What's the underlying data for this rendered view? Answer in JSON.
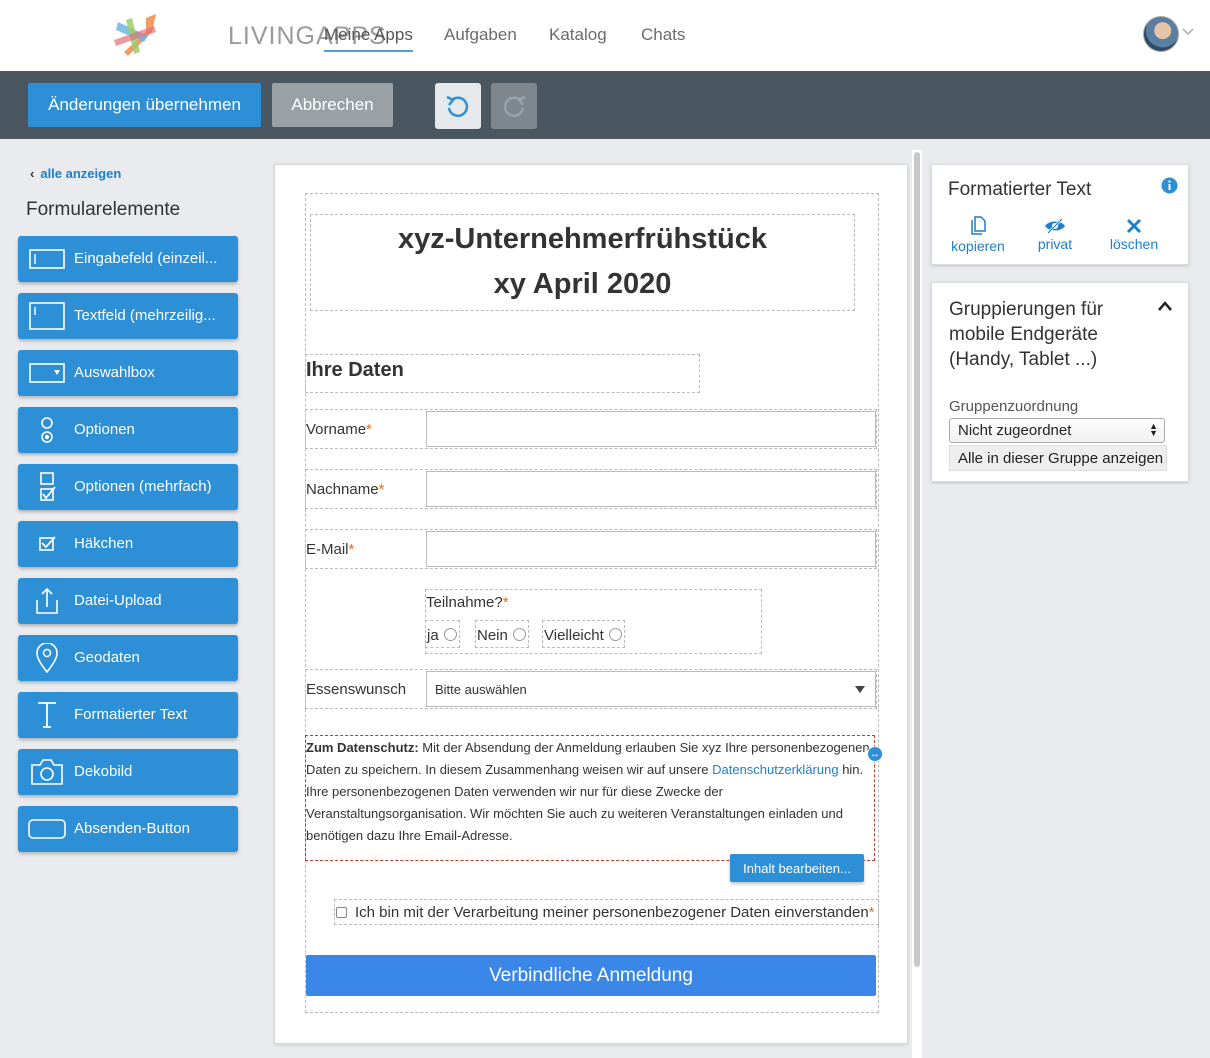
{
  "header": {
    "logo_text": "LIVINGAPPS",
    "nav": [
      "Meine Apps",
      "Aufgaben",
      "Katalog",
      "Chats"
    ],
    "active_tab": "Meine Apps"
  },
  "toolbar": {
    "apply_label": "Änderungen übernehmen",
    "cancel_label": "Abbrechen"
  },
  "sidebar": {
    "back_link": "alle anzeigen",
    "title": "Formularelemente",
    "items": [
      {
        "label": "Eingabefeld (einzeil...",
        "icon": "single-line-input-icon"
      },
      {
        "label": "Textfeld (mehrzeilig...",
        "icon": "multi-line-textarea-icon"
      },
      {
        "label": "Auswahlbox",
        "icon": "select-box-icon"
      },
      {
        "label": "Optionen",
        "icon": "radio-options-icon"
      },
      {
        "label": "Optionen (mehrfach)",
        "icon": "checkbox-options-icon"
      },
      {
        "label": "Häkchen",
        "icon": "checkmark-icon"
      },
      {
        "label": "Datei-Upload",
        "icon": "upload-icon"
      },
      {
        "label": "Geodaten",
        "icon": "map-pin-icon"
      },
      {
        "label": "Formatierter Text",
        "icon": "text-format-icon"
      },
      {
        "label": "Dekobild",
        "icon": "camera-icon"
      },
      {
        "label": "Absenden-Button",
        "icon": "submit-button-icon"
      }
    ]
  },
  "form": {
    "title_line1": "xyz-Unternehmerfrühstück",
    "title_line2": "xy April 2020",
    "section_title": "Ihre Daten",
    "fields": [
      {
        "label": "Vorname",
        "required": "*"
      },
      {
        "label": "Nachname",
        "required": "*"
      },
      {
        "label": "E-Mail",
        "required": "*"
      }
    ],
    "radio_question": "Teilnahme?",
    "radio_required": "*",
    "radio_options": [
      "ja",
      "Nein",
      "Vielleicht"
    ],
    "select_label": "Essenswunsch",
    "select_value": "Bitte auswählen",
    "privacy_bold": "Zum Datenschutz:",
    "privacy_part1": " Mit der Absendung der Anmeldung erlauben Sie xyz Ihre personenbezogenen Daten zu speichern. In diesem Zusammenhang weisen wir auf  unsere ",
    "privacy_link": "Datenschutzerklärung",
    "privacy_part2": " hin. Ihre personenbezogenen Daten verwenden wir nur für diese Zwecke der Veranstaltungsorganisation. Wir möchten Sie auch zu weiteren Veranstaltungen einladen und benötigen dazu Ihre Email-Adresse.",
    "edit_button": "Inhalt bearbeiten...",
    "consent_text": "Ich bin mit der Verarbeitung meiner personenbezogener Daten einverstanden",
    "consent_required": "*",
    "submit_label": "Verbindliche Anmeldung"
  },
  "properties_panel": {
    "title": "Formatierter Text",
    "actions": [
      {
        "label": "kopieren",
        "icon": "copy-icon"
      },
      {
        "label": "privat",
        "icon": "eye-slash-icon"
      },
      {
        "label": "löschen",
        "icon": "delete-x-icon"
      }
    ]
  },
  "grouping_panel": {
    "title": "Gruppierungen für mobile Endgeräte (Handy, Tablet ...)",
    "group_label": "Gruppenzuordnung",
    "group_value": "Nicht zugeordnet",
    "show_group_button": "Alle in dieser Gruppe anzeigen"
  },
  "colors": {
    "primary": "#2d8fd5",
    "toolbar_bg": "#4a5660",
    "submit": "#3b87e8",
    "required": "#e07020"
  }
}
